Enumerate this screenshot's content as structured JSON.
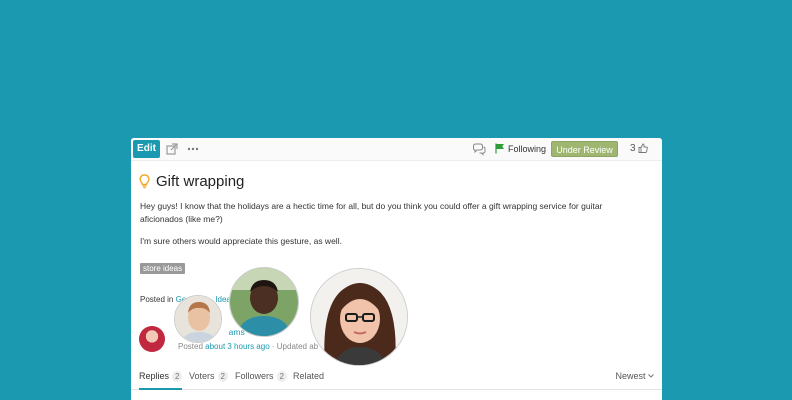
{
  "toolbar": {
    "edit_label": "Edit",
    "following_label": "Following",
    "status_label": "Under Review",
    "vote_count": "3",
    "icons": [
      "external-link-icon",
      "more-icon",
      "comments-icon",
      "flag-icon",
      "chevron-down-icon",
      "thumbs-up-icon"
    ]
  },
  "post": {
    "title": "Gift wrapping",
    "icon": "lightbulb-icon",
    "paragraphs": [
      "Hey guys! I know that the holidays are a hectic time for all, but do you think you could offer a gift wrapping service for guitar aficionados (like me?)",
      "I'm sure others would appreciate this gesture, as well."
    ],
    "tag": "store ideas",
    "posted_in_prefix": "Posted in",
    "category_visible": "Ge",
    "category_visible_end": "Ideas",
    "author_visible": "A",
    "author_visible_end": "ams",
    "meta_posted": "Posted",
    "meta_time": "about 3 hours ago",
    "meta_updated": "· Updated ab"
  },
  "tabs": [
    {
      "label": "Replies",
      "count": "2"
    },
    {
      "label": "Voters",
      "count": "2"
    },
    {
      "label": "Followers",
      "count": "2"
    },
    {
      "label": "Related",
      "count": ""
    }
  ],
  "sort_label": "Newest",
  "colors": {
    "background": "#1a99b0",
    "accent": "#1a99b0",
    "status": "#9fb670",
    "flag": "#2e9e3a",
    "bulb": "#f0a92c"
  }
}
